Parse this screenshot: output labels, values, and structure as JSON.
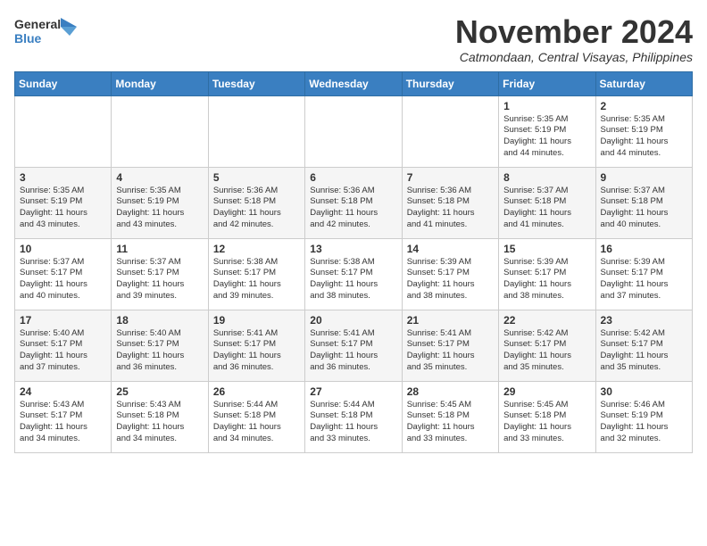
{
  "logo": {
    "general": "General",
    "blue": "Blue"
  },
  "header": {
    "month": "November 2024",
    "location": "Catmondaan, Central Visayas, Philippines"
  },
  "weekdays": [
    "Sunday",
    "Monday",
    "Tuesday",
    "Wednesday",
    "Thursday",
    "Friday",
    "Saturday"
  ],
  "weeks": [
    [
      {
        "day": "",
        "info": ""
      },
      {
        "day": "",
        "info": ""
      },
      {
        "day": "",
        "info": ""
      },
      {
        "day": "",
        "info": ""
      },
      {
        "day": "",
        "info": ""
      },
      {
        "day": "1",
        "info": "Sunrise: 5:35 AM\nSunset: 5:19 PM\nDaylight: 11 hours\nand 44 minutes."
      },
      {
        "day": "2",
        "info": "Sunrise: 5:35 AM\nSunset: 5:19 PM\nDaylight: 11 hours\nand 44 minutes."
      }
    ],
    [
      {
        "day": "3",
        "info": "Sunrise: 5:35 AM\nSunset: 5:19 PM\nDaylight: 11 hours\nand 43 minutes."
      },
      {
        "day": "4",
        "info": "Sunrise: 5:35 AM\nSunset: 5:19 PM\nDaylight: 11 hours\nand 43 minutes."
      },
      {
        "day": "5",
        "info": "Sunrise: 5:36 AM\nSunset: 5:18 PM\nDaylight: 11 hours\nand 42 minutes."
      },
      {
        "day": "6",
        "info": "Sunrise: 5:36 AM\nSunset: 5:18 PM\nDaylight: 11 hours\nand 42 minutes."
      },
      {
        "day": "7",
        "info": "Sunrise: 5:36 AM\nSunset: 5:18 PM\nDaylight: 11 hours\nand 41 minutes."
      },
      {
        "day": "8",
        "info": "Sunrise: 5:37 AM\nSunset: 5:18 PM\nDaylight: 11 hours\nand 41 minutes."
      },
      {
        "day": "9",
        "info": "Sunrise: 5:37 AM\nSunset: 5:18 PM\nDaylight: 11 hours\nand 40 minutes."
      }
    ],
    [
      {
        "day": "10",
        "info": "Sunrise: 5:37 AM\nSunset: 5:17 PM\nDaylight: 11 hours\nand 40 minutes."
      },
      {
        "day": "11",
        "info": "Sunrise: 5:37 AM\nSunset: 5:17 PM\nDaylight: 11 hours\nand 39 minutes."
      },
      {
        "day": "12",
        "info": "Sunrise: 5:38 AM\nSunset: 5:17 PM\nDaylight: 11 hours\nand 39 minutes."
      },
      {
        "day": "13",
        "info": "Sunrise: 5:38 AM\nSunset: 5:17 PM\nDaylight: 11 hours\nand 38 minutes."
      },
      {
        "day": "14",
        "info": "Sunrise: 5:39 AM\nSunset: 5:17 PM\nDaylight: 11 hours\nand 38 minutes."
      },
      {
        "day": "15",
        "info": "Sunrise: 5:39 AM\nSunset: 5:17 PM\nDaylight: 11 hours\nand 38 minutes."
      },
      {
        "day": "16",
        "info": "Sunrise: 5:39 AM\nSunset: 5:17 PM\nDaylight: 11 hours\nand 37 minutes."
      }
    ],
    [
      {
        "day": "17",
        "info": "Sunrise: 5:40 AM\nSunset: 5:17 PM\nDaylight: 11 hours\nand 37 minutes."
      },
      {
        "day": "18",
        "info": "Sunrise: 5:40 AM\nSunset: 5:17 PM\nDaylight: 11 hours\nand 36 minutes."
      },
      {
        "day": "19",
        "info": "Sunrise: 5:41 AM\nSunset: 5:17 PM\nDaylight: 11 hours\nand 36 minutes."
      },
      {
        "day": "20",
        "info": "Sunrise: 5:41 AM\nSunset: 5:17 PM\nDaylight: 11 hours\nand 36 minutes."
      },
      {
        "day": "21",
        "info": "Sunrise: 5:41 AM\nSunset: 5:17 PM\nDaylight: 11 hours\nand 35 minutes."
      },
      {
        "day": "22",
        "info": "Sunrise: 5:42 AM\nSunset: 5:17 PM\nDaylight: 11 hours\nand 35 minutes."
      },
      {
        "day": "23",
        "info": "Sunrise: 5:42 AM\nSunset: 5:17 PM\nDaylight: 11 hours\nand 35 minutes."
      }
    ],
    [
      {
        "day": "24",
        "info": "Sunrise: 5:43 AM\nSunset: 5:17 PM\nDaylight: 11 hours\nand 34 minutes."
      },
      {
        "day": "25",
        "info": "Sunrise: 5:43 AM\nSunset: 5:18 PM\nDaylight: 11 hours\nand 34 minutes."
      },
      {
        "day": "26",
        "info": "Sunrise: 5:44 AM\nSunset: 5:18 PM\nDaylight: 11 hours\nand 34 minutes."
      },
      {
        "day": "27",
        "info": "Sunrise: 5:44 AM\nSunset: 5:18 PM\nDaylight: 11 hours\nand 33 minutes."
      },
      {
        "day": "28",
        "info": "Sunrise: 5:45 AM\nSunset: 5:18 PM\nDaylight: 11 hours\nand 33 minutes."
      },
      {
        "day": "29",
        "info": "Sunrise: 5:45 AM\nSunset: 5:18 PM\nDaylight: 11 hours\nand 33 minutes."
      },
      {
        "day": "30",
        "info": "Sunrise: 5:46 AM\nSunset: 5:19 PM\nDaylight: 11 hours\nand 32 minutes."
      }
    ]
  ]
}
